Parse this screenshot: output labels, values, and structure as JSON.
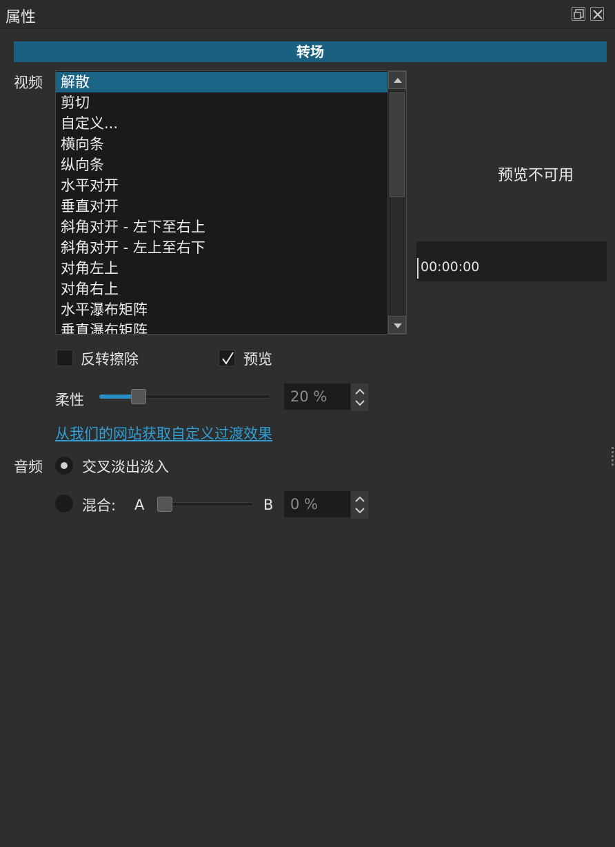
{
  "window": {
    "title": "属性"
  },
  "section_header": "转场",
  "video": {
    "label": "视频",
    "transitions": [
      "解散",
      "剪切",
      "自定义...",
      "横向条",
      "纵向条",
      "水平对开",
      "垂直对开",
      "斜角对开 - 左下至右上",
      "斜角对开 - 左上至右下",
      "对角左上",
      "对角右上",
      "水平瀑布矩阵",
      "垂直瀑布矩阵"
    ],
    "selected": "解散",
    "preview_unavailable": "预览不可用",
    "timecode": "00:00:00",
    "invert_wipe": {
      "label": "反转擦除",
      "checked": false
    },
    "preview": {
      "label": "预览",
      "checked": true,
      "check_glyph": "✓"
    },
    "softness": {
      "label": "柔性",
      "value_text": "20 %",
      "value_percent": 20
    },
    "link_text": "从我们的网站获取自定义过渡效果"
  },
  "audio": {
    "label": "音频",
    "crossfade": {
      "label": "交叉淡出淡入",
      "selected": true
    },
    "mix": {
      "label": "混合:",
      "a_label": "A",
      "b_label": "B",
      "value_text": "0 %",
      "value_percent": 0,
      "selected": false
    }
  },
  "colors": {
    "accent": "#1a6080",
    "selection": "#1c6486",
    "link": "#2f9fd6",
    "background": "#2e2e2e"
  }
}
